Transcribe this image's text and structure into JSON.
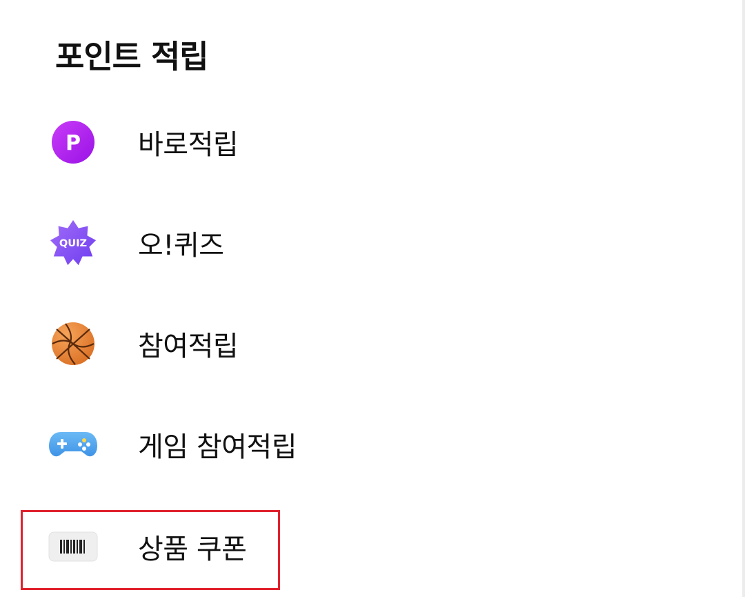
{
  "section": {
    "title": "포인트 적립"
  },
  "menu": {
    "items": [
      {
        "label": "바로적립",
        "icon": "point-p-icon"
      },
      {
        "label": "오!퀴즈",
        "icon": "quiz-badge-icon",
        "icon_text": "QUIZ"
      },
      {
        "label": "참여적립",
        "icon": "basketball-icon"
      },
      {
        "label": "게임 참여적립",
        "icon": "gamepad-icon"
      },
      {
        "label": "상품 쿠폰",
        "icon": "barcode-icon"
      }
    ]
  },
  "highlight": {
    "target": "상품 쿠폰",
    "color": "#e0222e"
  },
  "colors": {
    "point_purple": "#b226f2",
    "quiz_purple": "#8a55f5",
    "basketball_orange": "#e8873a",
    "gamepad_blue": "#4aa3ee",
    "text": "#111111"
  }
}
